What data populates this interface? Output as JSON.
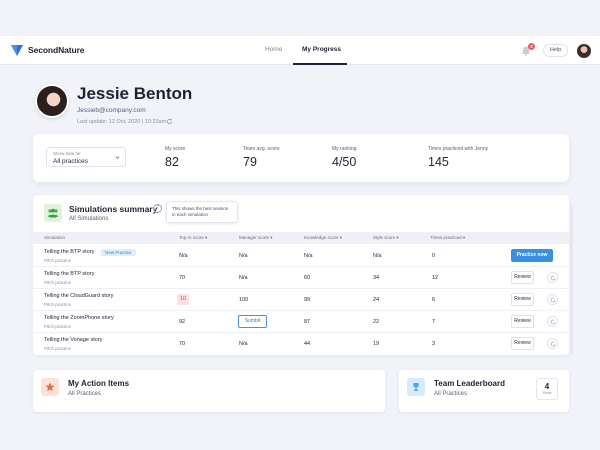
{
  "app": {
    "name": "SecondNature"
  },
  "nav": {
    "home": "Home",
    "my_progress": "My Progress",
    "notification_count": "2",
    "help": "Help"
  },
  "profile": {
    "name": "Jessie Benton",
    "email": "Jessieb@company.com",
    "last_update": "Last update: 12 Oct, 2020 | 10:23am"
  },
  "stats": {
    "show_data_label": "Show data for",
    "show_data_value": "All practices",
    "items": [
      {
        "label": "My score",
        "value": "82"
      },
      {
        "label": "Team avg. score",
        "value": "79"
      },
      {
        "label": "My ranking",
        "value": "4/50"
      },
      {
        "label": "Times practiced with Jenny",
        "value": "145"
      }
    ]
  },
  "simulations": {
    "title": "Simulations summary",
    "subtitle": "All Simulations",
    "tooltip": "This shows the best session in each simulation",
    "columns": {
      "simulation": "Simulation",
      "top_ai": "Top AI score",
      "manager": "Manager score",
      "knowledge": "Knowledge score",
      "style": "Style score",
      "times": "Times practiced"
    },
    "rows": [
      {
        "name": "Telling the BTP story",
        "sub": "Pitch practice",
        "badge": "New Practice",
        "ai": "N/a",
        "manager": "N/a",
        "knowledge": "N/a",
        "style": "N/a",
        "times": "0",
        "action": "Practice now"
      },
      {
        "name": "Telling the BTP story",
        "sub": "Pitch practice",
        "ai": "70",
        "manager": "N/a",
        "knowledge": "60",
        "style": "34",
        "times": "12",
        "action": "Review"
      },
      {
        "name": "Telling the CloudGuard story",
        "sub": "Pitch practice",
        "ai": "10",
        "manager": "100",
        "knowledge": "99",
        "style": "24",
        "times": "6",
        "action": "Review"
      },
      {
        "name": "Telling the ZoomPhone story",
        "sub": "Pitch practice",
        "ai": "92",
        "manager": "Sumbit",
        "knowledge": "87",
        "style": "22",
        "times": "7",
        "action": "Review"
      },
      {
        "name": "Telling the Vonage story",
        "sub": "Pitch practice",
        "ai": "70",
        "manager": "N/a",
        "knowledge": "44",
        "style": "19",
        "times": "3",
        "action": "Review"
      }
    ]
  },
  "action_items": {
    "title": "My Action Items",
    "subtitle": "All Practices"
  },
  "leaderboard": {
    "title": "Team Leaderboard",
    "subtitle": "All Practices",
    "count": "4",
    "count_label": "Seats"
  },
  "colors": {
    "accent": "#3b8fe0",
    "brand": "#2f6fd6",
    "danger": "#d24f4f"
  }
}
